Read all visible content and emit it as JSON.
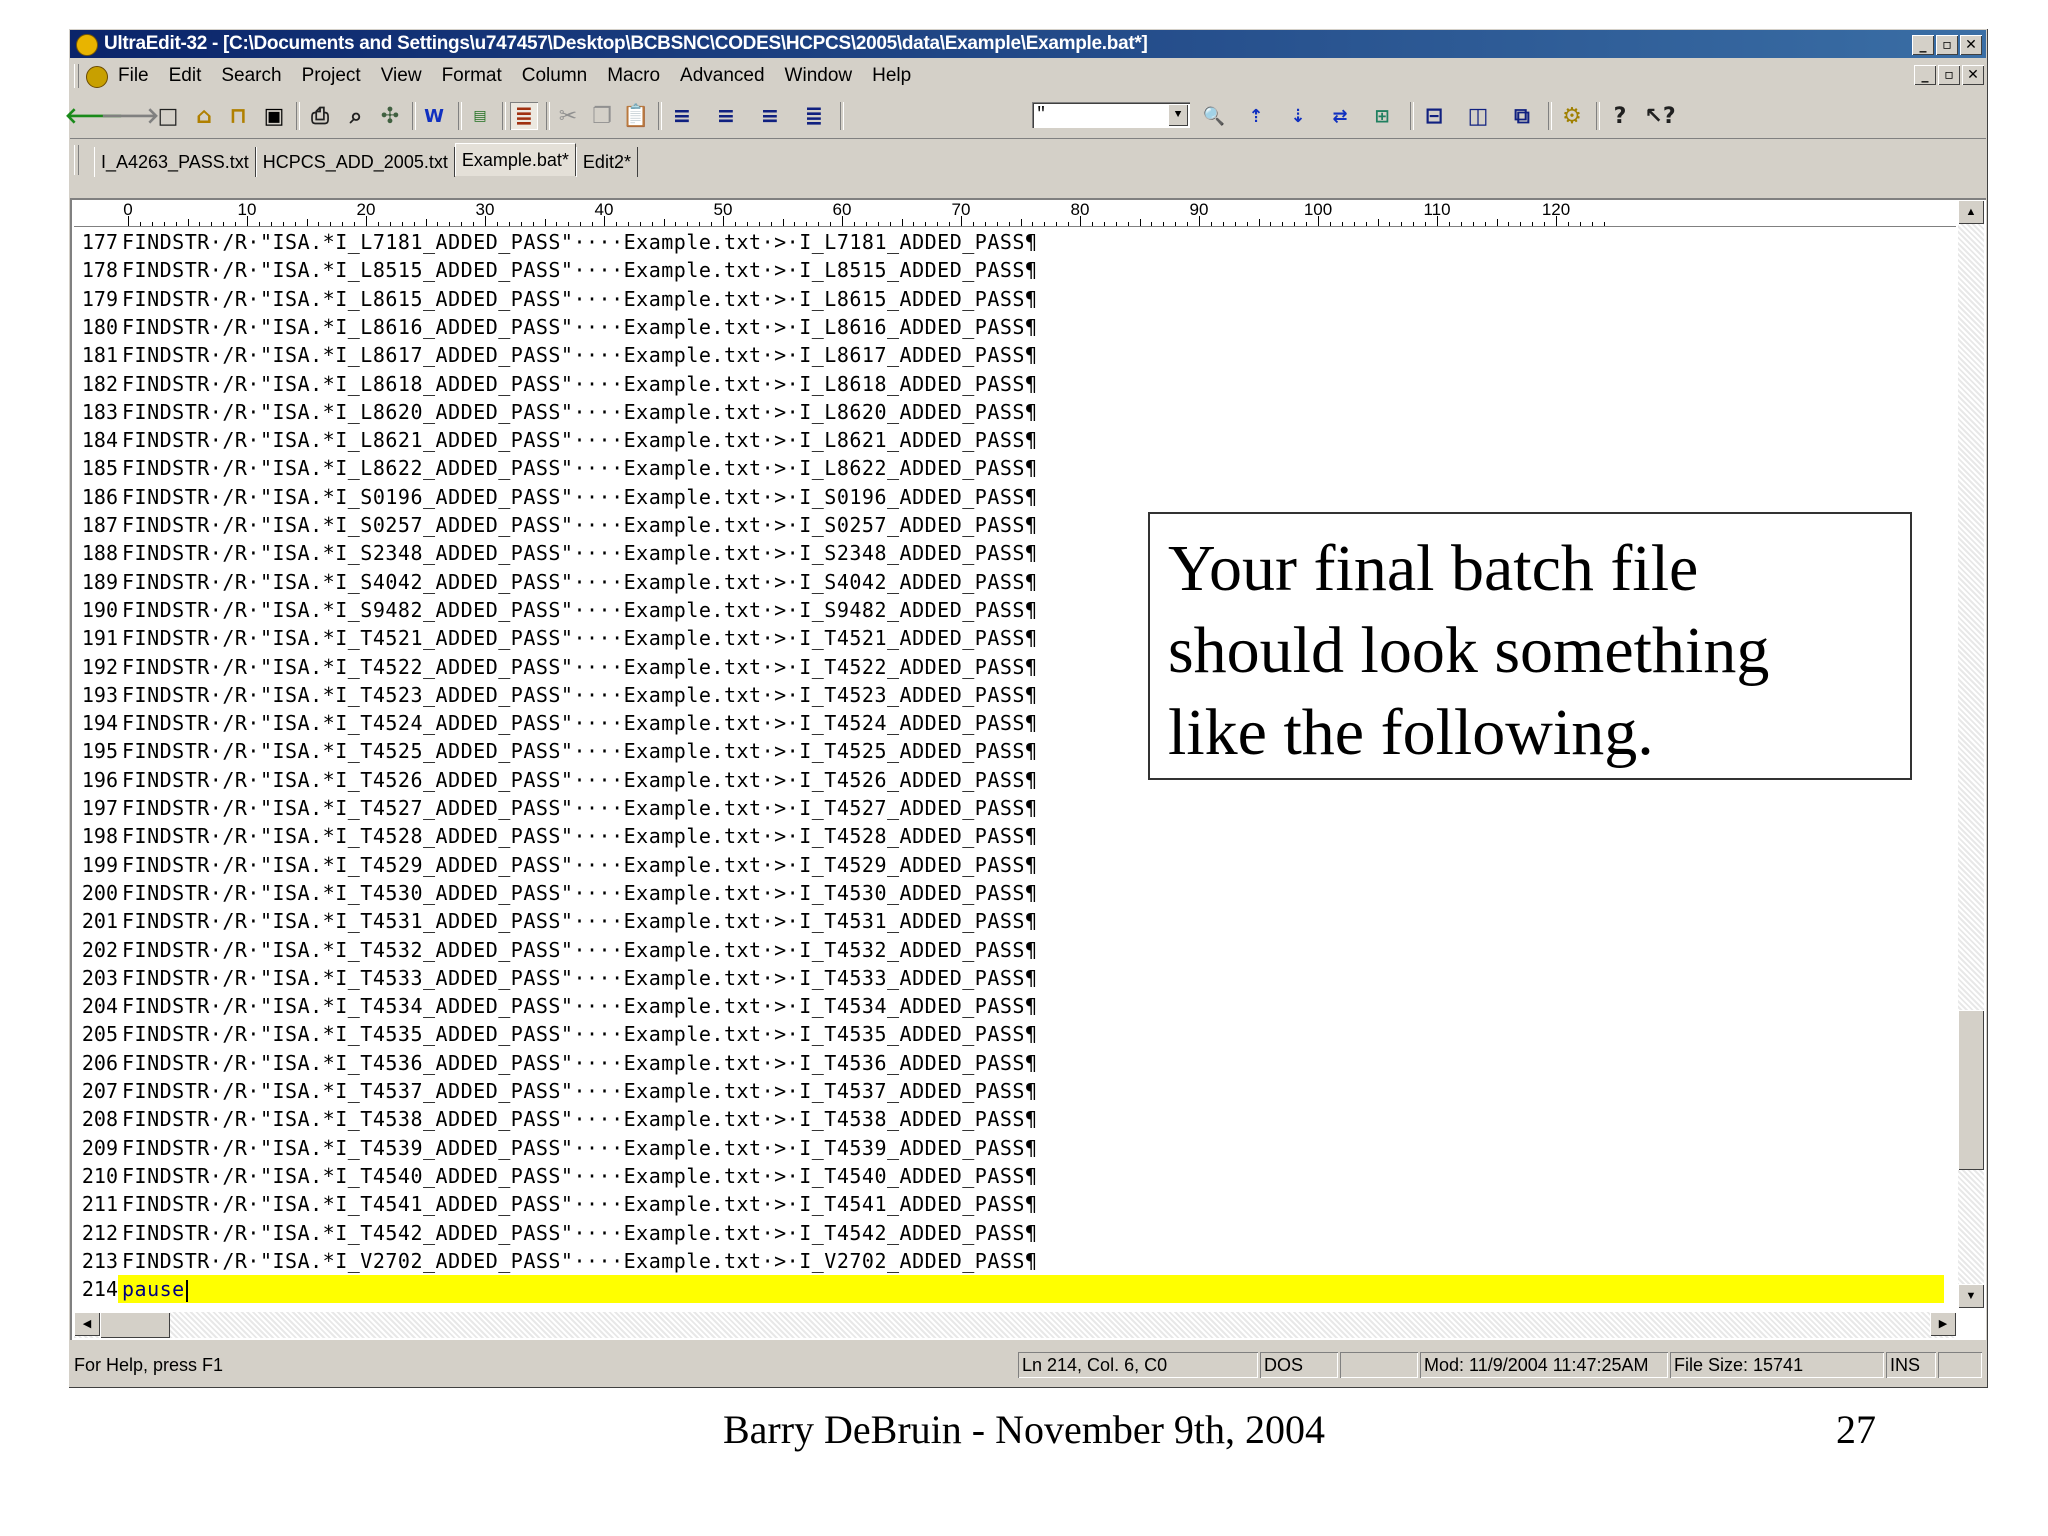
{
  "window": {
    "title": "UltraEdit-32 - [C:\\Documents and Settings\\u747457\\Desktop\\BCBSNC\\CODES\\HCPCS\\2005\\data\\Example\\Example.bat*]",
    "minimize_glyph": "_",
    "restore_glyph": "▫",
    "close_glyph": "✕"
  },
  "menu": {
    "items": [
      "File",
      "Edit",
      "Search",
      "Project",
      "View",
      "Format",
      "Column",
      "Macro",
      "Advanced",
      "Window",
      "Help"
    ]
  },
  "toolbar": {
    "combo_value": "\"",
    "icons": [
      "back-arrow-icon",
      "forward-arrow-icon",
      "new-file-icon",
      "open-folder-icon",
      "close-file-icon",
      "save-icon",
      "print-icon",
      "print-preview-icon",
      "spell-icon",
      "word-wrap-icon",
      "hex-icon",
      "column-mode-icon",
      "cut-icon",
      "copy-icon",
      "paste-icon",
      "align-left-icon",
      "align-center-icon",
      "align-right-icon",
      "justify-icon",
      "find-icon",
      "find-prev-icon",
      "find-next-icon",
      "replace-icon",
      "find-in-files-icon",
      "split-horizontal-icon",
      "split-vertical-icon",
      "cascade-icon",
      "macro-icon",
      "help-icon",
      "context-help-icon"
    ]
  },
  "tabs": [
    {
      "label": "I_A4263_PASS.txt",
      "active": false
    },
    {
      "label": "HCPCS_ADD_2005.txt",
      "active": false
    },
    {
      "label": "Example.bat*",
      "active": true
    },
    {
      "label": "Edit2*",
      "active": false
    }
  ],
  "ruler": {
    "labels": [
      "0",
      "10",
      "20",
      "30",
      "40",
      "50",
      "60",
      "70",
      "80",
      "90",
      "100",
      "110",
      "120"
    ]
  },
  "editor": {
    "lines": [
      {
        "num": "177",
        "text": "FINDSTR·/R·\"ISA.*I_L7181_ADDED_PASS\"····Example.txt·>·I_L7181_ADDED_PASS¶"
      },
      {
        "num": "178",
        "text": "FINDSTR·/R·\"ISA.*I_L8515_ADDED_PASS\"····Example.txt·>·I_L8515_ADDED_PASS¶"
      },
      {
        "num": "179",
        "text": "FINDSTR·/R·\"ISA.*I_L8615_ADDED_PASS\"····Example.txt·>·I_L8615_ADDED_PASS¶"
      },
      {
        "num": "180",
        "text": "FINDSTR·/R·\"ISA.*I_L8616_ADDED_PASS\"····Example.txt·>·I_L8616_ADDED_PASS¶"
      },
      {
        "num": "181",
        "text": "FINDSTR·/R·\"ISA.*I_L8617_ADDED_PASS\"····Example.txt·>·I_L8617_ADDED_PASS¶"
      },
      {
        "num": "182",
        "text": "FINDSTR·/R·\"ISA.*I_L8618_ADDED_PASS\"····Example.txt·>·I_L8618_ADDED_PASS¶"
      },
      {
        "num": "183",
        "text": "FINDSTR·/R·\"ISA.*I_L8620_ADDED_PASS\"····Example.txt·>·I_L8620_ADDED_PASS¶"
      },
      {
        "num": "184",
        "text": "FINDSTR·/R·\"ISA.*I_L8621_ADDED_PASS\"····Example.txt·>·I_L8621_ADDED_PASS¶"
      },
      {
        "num": "185",
        "text": "FINDSTR·/R·\"ISA.*I_L8622_ADDED_PASS\"····Example.txt·>·I_L8622_ADDED_PASS¶"
      },
      {
        "num": "186",
        "text": "FINDSTR·/R·\"ISA.*I_S0196_ADDED_PASS\"····Example.txt·>·I_S0196_ADDED_PASS¶"
      },
      {
        "num": "187",
        "text": "FINDSTR·/R·\"ISA.*I_S0257_ADDED_PASS\"····Example.txt·>·I_S0257_ADDED_PASS¶"
      },
      {
        "num": "188",
        "text": "FINDSTR·/R·\"ISA.*I_S2348_ADDED_PASS\"····Example.txt·>·I_S2348_ADDED_PASS¶"
      },
      {
        "num": "189",
        "text": "FINDSTR·/R·\"ISA.*I_S4042_ADDED_PASS\"····Example.txt·>·I_S4042_ADDED_PASS¶"
      },
      {
        "num": "190",
        "text": "FINDSTR·/R·\"ISA.*I_S9482_ADDED_PASS\"····Example.txt·>·I_S9482_ADDED_PASS¶"
      },
      {
        "num": "191",
        "text": "FINDSTR·/R·\"ISA.*I_T4521_ADDED_PASS\"····Example.txt·>·I_T4521_ADDED_PASS¶"
      },
      {
        "num": "192",
        "text": "FINDSTR·/R·\"ISA.*I_T4522_ADDED_PASS\"····Example.txt·>·I_T4522_ADDED_PASS¶"
      },
      {
        "num": "193",
        "text": "FINDSTR·/R·\"ISA.*I_T4523_ADDED_PASS\"····Example.txt·>·I_T4523_ADDED_PASS¶"
      },
      {
        "num": "194",
        "text": "FINDSTR·/R·\"ISA.*I_T4524_ADDED_PASS\"····Example.txt·>·I_T4524_ADDED_PASS¶"
      },
      {
        "num": "195",
        "text": "FINDSTR·/R·\"ISA.*I_T4525_ADDED_PASS\"····Example.txt·>·I_T4525_ADDED_PASS¶"
      },
      {
        "num": "196",
        "text": "FINDSTR·/R·\"ISA.*I_T4526_ADDED_PASS\"····Example.txt·>·I_T4526_ADDED_PASS¶"
      },
      {
        "num": "197",
        "text": "FINDSTR·/R·\"ISA.*I_T4527_ADDED_PASS\"····Example.txt·>·I_T4527_ADDED_PASS¶"
      },
      {
        "num": "198",
        "text": "FINDSTR·/R·\"ISA.*I_T4528_ADDED_PASS\"····Example.txt·>·I_T4528_ADDED_PASS¶"
      },
      {
        "num": "199",
        "text": "FINDSTR·/R·\"ISA.*I_T4529_ADDED_PASS\"····Example.txt·>·I_T4529_ADDED_PASS¶"
      },
      {
        "num": "200",
        "text": "FINDSTR·/R·\"ISA.*I_T4530_ADDED_PASS\"····Example.txt·>·I_T4530_ADDED_PASS¶"
      },
      {
        "num": "201",
        "text": "FINDSTR·/R·\"ISA.*I_T4531_ADDED_PASS\"····Example.txt·>·I_T4531_ADDED_PASS¶"
      },
      {
        "num": "202",
        "text": "FINDSTR·/R·\"ISA.*I_T4532_ADDED_PASS\"····Example.txt·>·I_T4532_ADDED_PASS¶"
      },
      {
        "num": "203",
        "text": "FINDSTR·/R·\"ISA.*I_T4533_ADDED_PASS\"····Example.txt·>·I_T4533_ADDED_PASS¶"
      },
      {
        "num": "204",
        "text": "FINDSTR·/R·\"ISA.*I_T4534_ADDED_PASS\"····Example.txt·>·I_T4534_ADDED_PASS¶"
      },
      {
        "num": "205",
        "text": "FINDSTR·/R·\"ISA.*I_T4535_ADDED_PASS\"····Example.txt·>·I_T4535_ADDED_PASS¶"
      },
      {
        "num": "206",
        "text": "FINDSTR·/R·\"ISA.*I_T4536_ADDED_PASS\"····Example.txt·>·I_T4536_ADDED_PASS¶"
      },
      {
        "num": "207",
        "text": "FINDSTR·/R·\"ISA.*I_T4537_ADDED_PASS\"····Example.txt·>·I_T4537_ADDED_PASS¶"
      },
      {
        "num": "208",
        "text": "FINDSTR·/R·\"ISA.*I_T4538_ADDED_PASS\"····Example.txt·>·I_T4538_ADDED_PASS¶"
      },
      {
        "num": "209",
        "text": "FINDSTR·/R·\"ISA.*I_T4539_ADDED_PASS\"····Example.txt·>·I_T4539_ADDED_PASS¶"
      },
      {
        "num": "210",
        "text": "FINDSTR·/R·\"ISA.*I_T4540_ADDED_PASS\"····Example.txt·>·I_T4540_ADDED_PASS¶"
      },
      {
        "num": "211",
        "text": "FINDSTR·/R·\"ISA.*I_T4541_ADDED_PASS\"····Example.txt·>·I_T4541_ADDED_PASS¶"
      },
      {
        "num": "212",
        "text": "FINDSTR·/R·\"ISA.*I_T4542_ADDED_PASS\"····Example.txt·>·I_T4542_ADDED_PASS¶"
      },
      {
        "num": "213",
        "text": "FINDSTR·/R·\"ISA.*I_V2702_ADDED_PASS\"····Example.txt·>·I_V2702_ADDED_PASS¶"
      },
      {
        "num": "214",
        "text": "pause",
        "current": true
      }
    ],
    "current_line_color": "#ffff00"
  },
  "status": {
    "help": "For Help, press F1",
    "position": "Ln 214, Col. 6, C0",
    "format": "DOS",
    "modified": "Mod: 11/9/2004 11:47:25AM",
    "file_size": "File Size: 15741",
    "mode": "INS"
  },
  "callout": {
    "lines": [
      "Your final batch file",
      "should look something",
      "like the following."
    ]
  },
  "footer": {
    "author": "Barry DeBruin - November 9th, 2004",
    "page": "27"
  }
}
